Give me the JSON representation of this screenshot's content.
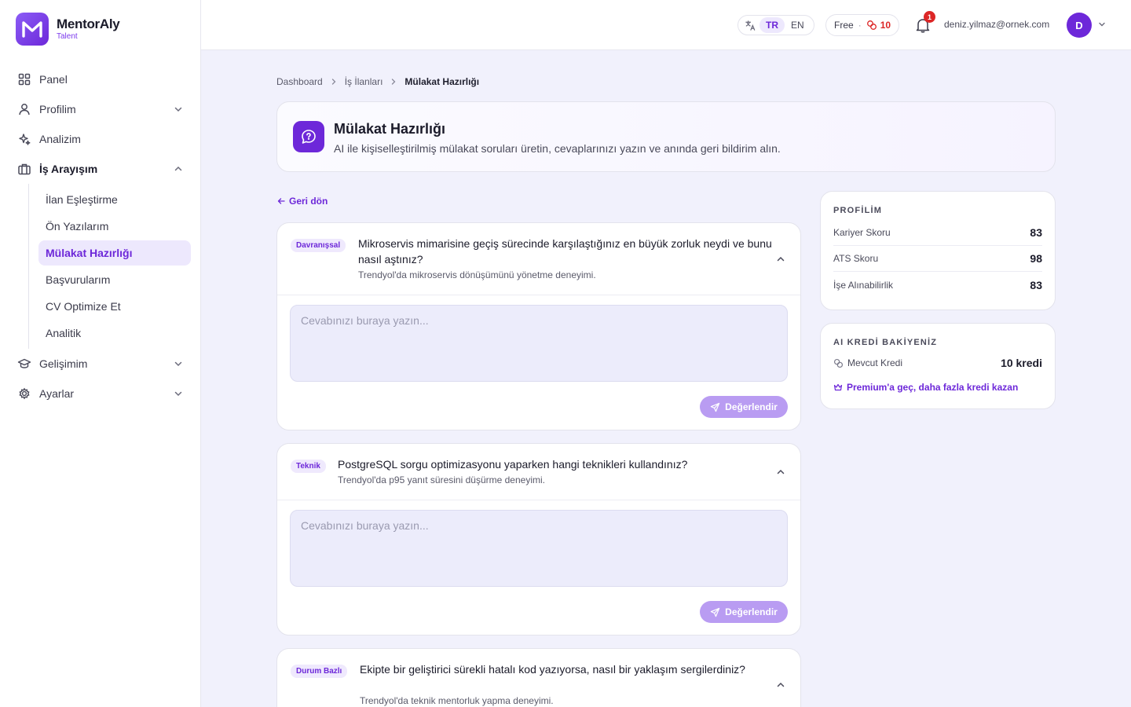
{
  "brand": {
    "name": "MentorAly",
    "sub": "Talent"
  },
  "sidebar": {
    "items": [
      {
        "label": "Panel"
      },
      {
        "label": "Profilim"
      },
      {
        "label": "Analizim"
      },
      {
        "label": "İş Arayışım"
      },
      {
        "label": "Gelişimim"
      },
      {
        "label": "Ayarlar"
      }
    ],
    "subitems": [
      {
        "label": "İlan Eşleştirme"
      },
      {
        "label": "Ön Yazılarım"
      },
      {
        "label": "Mülakat Hazırlığı"
      },
      {
        "label": "Başvurularım"
      },
      {
        "label": "CV Optimize Et"
      },
      {
        "label": "Analitik"
      }
    ]
  },
  "topbar": {
    "lang_tr": "TR",
    "lang_en": "EN",
    "plan": "Free",
    "plan_sep": "·",
    "credits": "10",
    "notifications": "1",
    "email": "deniz.yilmaz@ornek.com",
    "avatar_initial": "D"
  },
  "breadcrumb": {
    "home": "Dashboard",
    "parent": "İş İlanları",
    "current": "Mülakat Hazırlığı"
  },
  "hero": {
    "title": "Mülakat Hazırlığı",
    "desc": "AI ile kişiselleştirilmiş mülakat soruları üretin, cevaplarınızı yazın ve anında geri bildirim alın."
  },
  "back_label": "Geri dön",
  "questions": [
    {
      "tag": "Davranışsal",
      "text": "Mikroservis mimarisine geçiş sürecinde karşılaştığınız en büyük zorluk neydi ve bunu nasıl aştınız?",
      "sub": "Trendyol'da mikroservis dönüşümünü yönetme deneyimi.",
      "placeholder": "Cevabınızı buraya yazın...",
      "button": "Değerlendir"
    },
    {
      "tag": "Teknik",
      "text": "PostgreSQL sorgu optimizasyonu yaparken hangi teknikleri kullandınız?",
      "sub": "Trendyol'da p95 yanıt süresini düşürme deneyimi.",
      "placeholder": "Cevabınızı buraya yazın...",
      "button": "Değerlendir"
    },
    {
      "tag": "Durum Bazlı",
      "text": "Ekipte bir geliştirici sürekli hatalı kod yazıyorsa, nasıl bir yaklaşım sergilerdiniz?",
      "sub": "Trendyol'da teknik mentorluk yapma deneyimi."
    }
  ],
  "profile": {
    "title": "PROFİLİM",
    "rows": [
      {
        "label": "Kariyer Skoru",
        "value": "83"
      },
      {
        "label": "ATS Skoru",
        "value": "98"
      },
      {
        "label": "İşe Alınabilirlik",
        "value": "83"
      }
    ]
  },
  "credits_panel": {
    "title": "AI KREDİ BAKİYENİZ",
    "label": "Mevcut Kredi",
    "value": "10 kredi",
    "premium": "Premium'a geç, daha fazla kredi kazan"
  },
  "colors": {
    "accent": "#6d28d9",
    "accent_light": "#ede8fd",
    "danger": "#dc2626",
    "background": "#f1f1fc"
  }
}
